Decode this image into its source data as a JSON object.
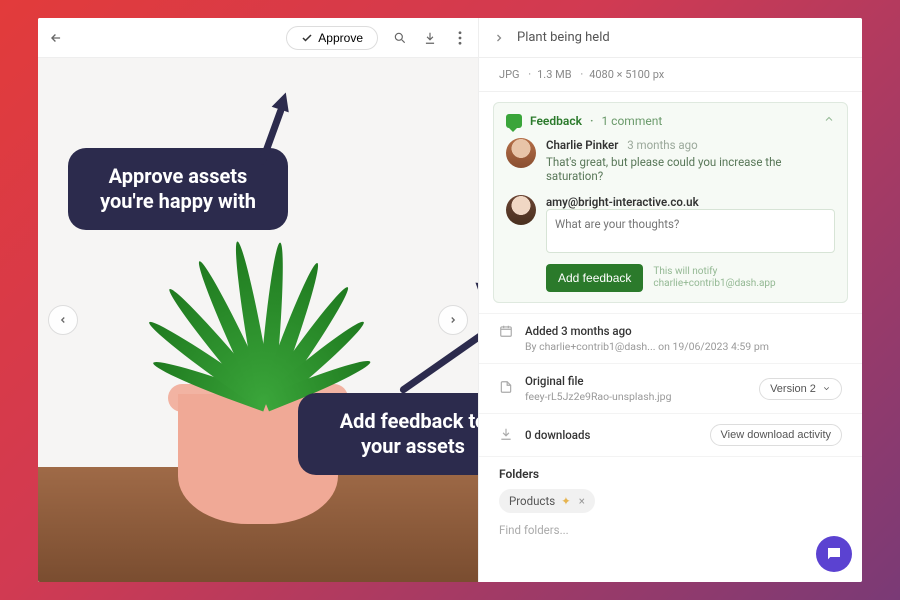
{
  "toolbar": {
    "approve_label": "Approve"
  },
  "annotations": {
    "approve_callout": "Approve assets you're happy with",
    "feedback_callout": "Add feedback to your assets"
  },
  "panel": {
    "title": "Plant being held",
    "meta": {
      "format": "JPG",
      "size": "1.3 MB",
      "dimensions": "4080 × 5100 px"
    },
    "feedback": {
      "heading": "Feedback",
      "count_label": "1 comment",
      "comment": {
        "author": "Charlie Pinker",
        "time": "3 months ago",
        "text": "That's great, but please could you increase the saturation?"
      },
      "reply": {
        "user": "amy@bright-interactive.co.uk",
        "placeholder": "What are your thoughts?",
        "button": "Add feedback",
        "notify_line1": "This will notify",
        "notify_line2": "charlie+contrib1@dash.app"
      }
    },
    "added": {
      "title": "Added 3 months ago",
      "by": "By charlie+contrib1@dash... on 19/06/2023 4:59 pm"
    },
    "file": {
      "title": "Original file",
      "name": "feey-rL5Jz2e9Rao-unsplash.jpg",
      "version_label": "Version 2"
    },
    "downloads": {
      "title": "0 downloads",
      "button": "View download activity"
    },
    "folders": {
      "heading": "Folders",
      "chip": "Products",
      "find_placeholder": "Find folders..."
    }
  }
}
